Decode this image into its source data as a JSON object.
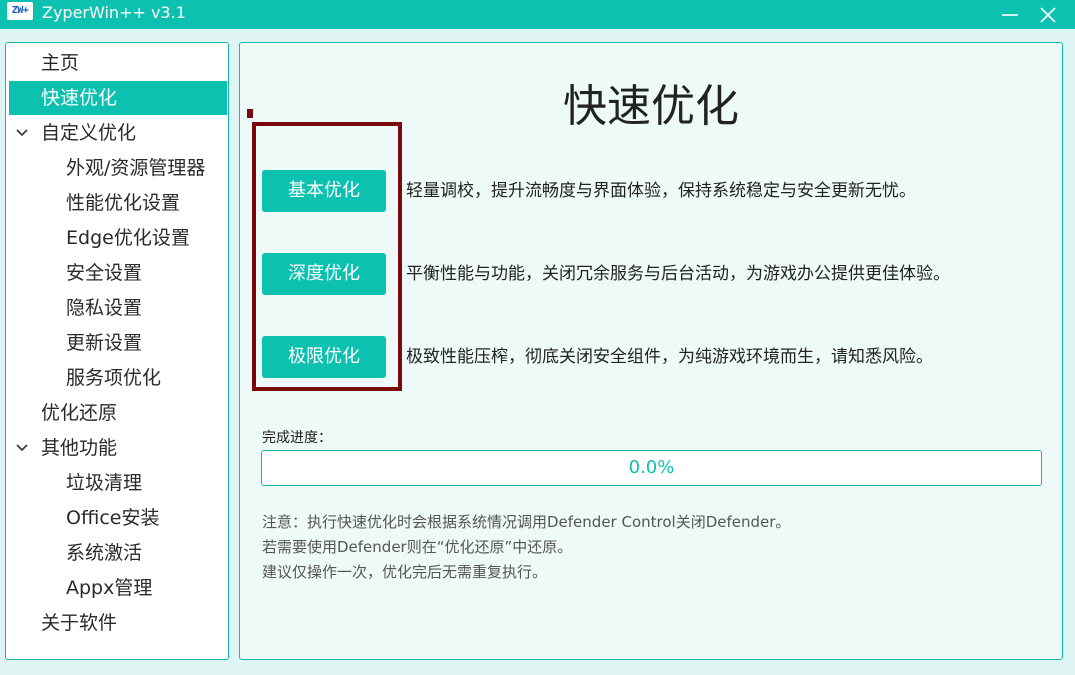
{
  "window": {
    "icon_text": "ZW+",
    "title": "ZyperWin++ v3.1",
    "accent_color": "#0cc1b0"
  },
  "sidebar": {
    "items": [
      {
        "label": "主页",
        "level": 0,
        "selected": false
      },
      {
        "label": "快速优化",
        "level": 0,
        "selected": true
      },
      {
        "label": "自定义优化",
        "level": 0,
        "expanded": true
      },
      {
        "label": "外观/资源管理器",
        "level": 1
      },
      {
        "label": "性能优化设置",
        "level": 1
      },
      {
        "label": "Edge优化设置",
        "level": 1
      },
      {
        "label": "安全设置",
        "level": 1
      },
      {
        "label": "隐私设置",
        "level": 1
      },
      {
        "label": "更新设置",
        "level": 1
      },
      {
        "label": "服务项优化",
        "level": 1
      },
      {
        "label": "优化还原",
        "level": 0
      },
      {
        "label": "其他功能",
        "level": 0,
        "expanded": true
      },
      {
        "label": "垃圾清理",
        "level": 1
      },
      {
        "label": "Office安装",
        "level": 1
      },
      {
        "label": "系统激活",
        "level": 1
      },
      {
        "label": "Appx管理",
        "level": 1
      },
      {
        "label": "关于软件",
        "level": 0
      }
    ]
  },
  "main": {
    "title": "快速优化",
    "options": [
      {
        "button": "基本优化",
        "description": "轻量调校，提升流畅度与界面体验，保持系统稳定与安全更新无忧。"
      },
      {
        "button": "深度优化",
        "description": "平衡性能与功能，关闭冗余服务与后台活动，为游戏办公提供更佳体验。"
      },
      {
        "button": "极限优化",
        "description": "极致性能压榨，彻底关闭安全组件，为纯游戏环境而生，请知悉风险。"
      }
    ],
    "progress": {
      "label": "完成进度：",
      "value": 0.0,
      "text": "0.0%"
    },
    "notes": [
      "注意：执行快速优化时会根据系统情况调用Defender Control关闭Defender。",
      "若需要使用Defender则在“优化还原”中还原。",
      "建议仅操作一次，优化完后无需重复执行。"
    ]
  }
}
